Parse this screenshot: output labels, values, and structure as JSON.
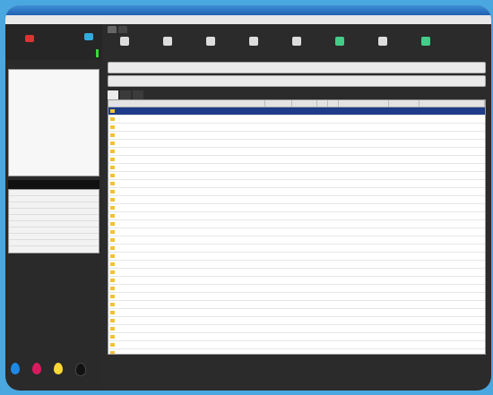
{
  "window": {
    "title": ""
  },
  "menu": [
    "",
    "",
    "",
    "",
    "",
    ""
  ],
  "left": {
    "labels": [
      "",
      ""
    ],
    "band": "",
    "list": [
      "",
      "",
      "",
      "",
      "",
      "",
      "",
      "",
      ""
    ]
  },
  "right": {
    "tabs": [
      "",
      ""
    ],
    "toolbar": [
      "",
      "",
      "",
      "",
      "",
      "",
      "",
      "",
      "",
      ""
    ],
    "address": [
      "",
      ""
    ],
    "subtabs": [
      "",
      "",
      ""
    ],
    "columns": [
      "",
      "",
      "",
      "",
      "",
      "",
      "",
      ""
    ],
    "rows": [
      [
        "",
        "",
        "",
        "",
        "",
        "",
        "",
        ""
      ],
      [
        "",
        "",
        "",
        "",
        "",
        "",
        "",
        ""
      ],
      [
        "",
        "",
        "",
        "",
        "",
        "",
        "",
        ""
      ],
      [
        "",
        "",
        "",
        "",
        "",
        "",
        "",
        ""
      ],
      [
        "",
        "",
        "",
        "",
        "",
        "",
        "",
        ""
      ],
      [
        "",
        "",
        "",
        "",
        "",
        "",
        "",
        ""
      ],
      [
        "",
        "",
        "",
        "",
        "",
        "",
        "",
        ""
      ],
      [
        "",
        "",
        "",
        "",
        "",
        "",
        "",
        ""
      ],
      [
        "",
        "",
        "",
        "",
        "",
        "",
        "",
        ""
      ],
      [
        "",
        "",
        "",
        "",
        "",
        "",
        "",
        ""
      ],
      [
        "",
        "",
        "",
        "",
        "",
        "",
        "",
        ""
      ],
      [
        "",
        "",
        "",
        "",
        "",
        "",
        "",
        ""
      ],
      [
        "",
        "",
        "",
        "",
        "",
        "",
        "",
        ""
      ],
      [
        "",
        "",
        "",
        "",
        "",
        "",
        "",
        ""
      ],
      [
        "",
        "",
        "",
        "",
        "",
        "",
        "",
        ""
      ],
      [
        "",
        "",
        "",
        "",
        "",
        "",
        "",
        ""
      ],
      [
        "",
        "",
        "",
        "",
        "",
        "",
        "",
        ""
      ],
      [
        "",
        "",
        "",
        "",
        "",
        "",
        "",
        ""
      ],
      [
        "",
        "",
        "",
        "",
        "",
        "",
        "",
        ""
      ],
      [
        "",
        "",
        "",
        "",
        "",
        "",
        "",
        ""
      ],
      [
        "",
        "",
        "",
        "",
        "",
        "",
        "",
        ""
      ],
      [
        "",
        "",
        "",
        "",
        "",
        "",
        "",
        ""
      ],
      [
        "",
        "",
        "",
        "",
        "",
        "",
        "",
        ""
      ],
      [
        "",
        "",
        "",
        "",
        "",
        "",
        "",
        ""
      ],
      [
        "",
        "",
        "",
        "",
        "",
        "",
        "",
        ""
      ],
      [
        "",
        "",
        "",
        "",
        "",
        "",
        "",
        ""
      ],
      [
        "",
        "",
        "",
        "",
        "",
        "",
        "",
        ""
      ],
      [
        "",
        "",
        "",
        "",
        "",
        "",
        "",
        ""
      ],
      [
        "",
        "",
        "",
        "",
        "",
        "",
        "",
        ""
      ],
      [
        "",
        "",
        "",
        "",
        "",
        "",
        "",
        ""
      ],
      [
        "",
        "",
        "",
        "",
        "",
        "",
        "",
        ""
      ],
      [
        "",
        "",
        "",
        "",
        "",
        "",
        "",
        ""
      ],
      [
        "",
        "",
        "",
        "",
        "",
        "",
        "",
        ""
      ],
      [
        "",
        "",
        "",
        "",
        "",
        "",
        "",
        ""
      ]
    ]
  },
  "colors": {
    "frame_bg": "#4aa7df",
    "dark_panel": "#2b2b2b",
    "selection": "#1e3c8a",
    "folder": "#f2c230",
    "drop_colors": [
      "#1e88e5",
      "#d81b60",
      "#fdd835",
      "#111111"
    ]
  }
}
